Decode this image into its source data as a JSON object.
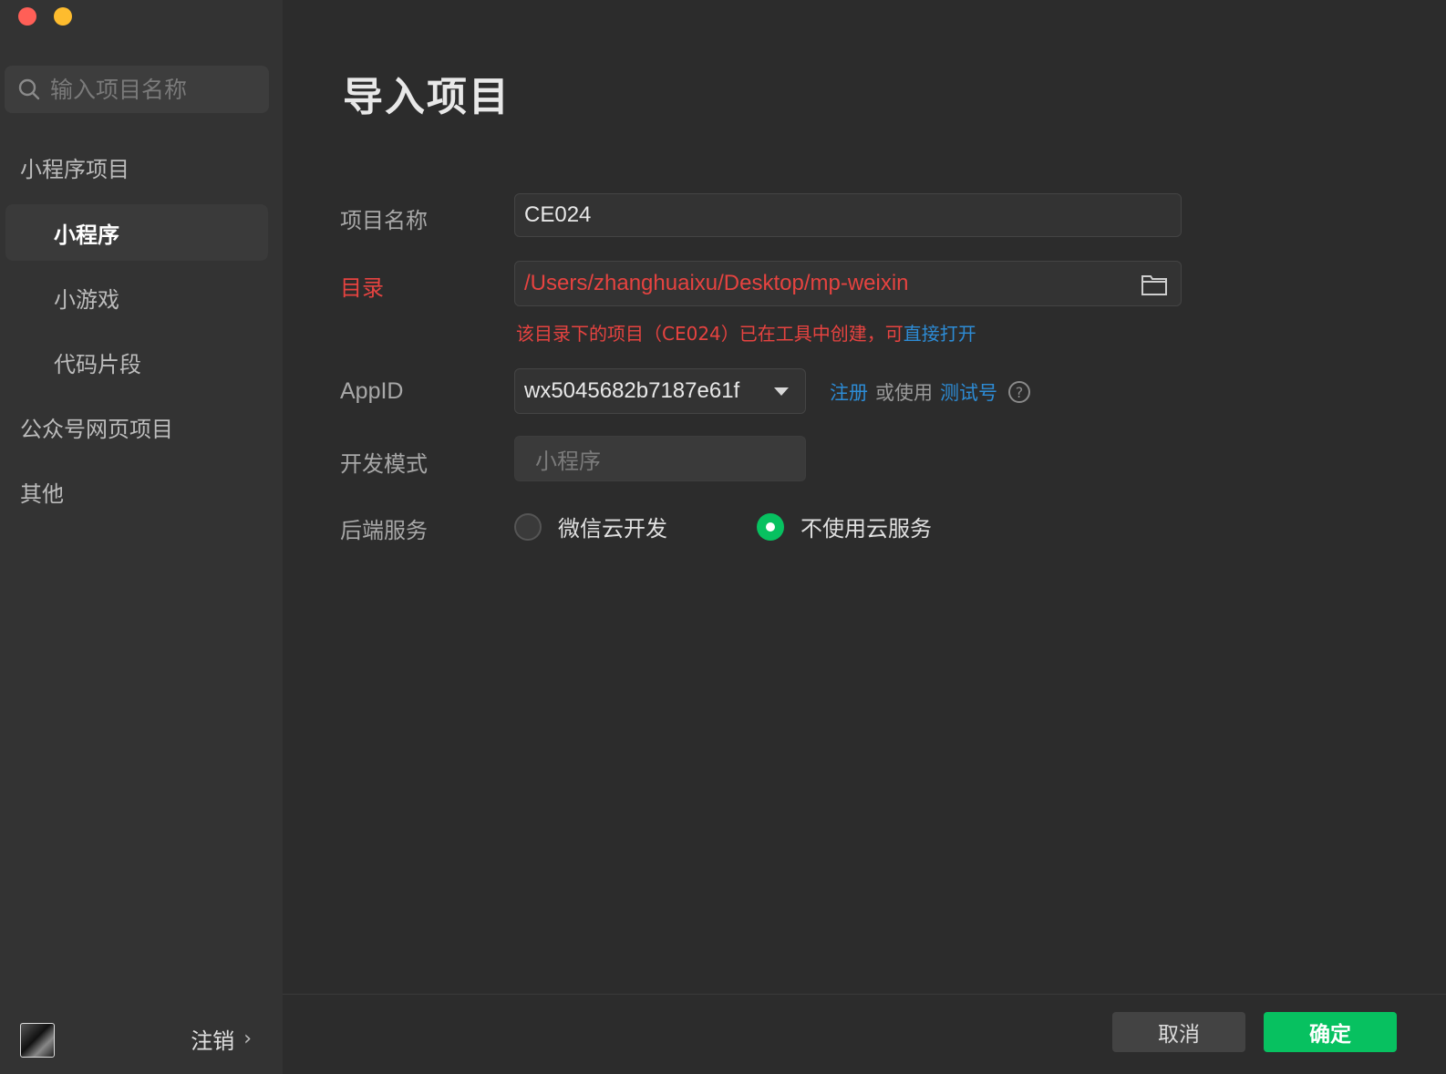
{
  "sidebar": {
    "search_placeholder": "输入项目名称",
    "groups": [
      {
        "label": "小程序项目"
      },
      {
        "label": "公众号网页项目"
      },
      {
        "label": "其他"
      }
    ],
    "items": [
      {
        "label": "小程序",
        "active": true
      },
      {
        "label": "小游戏",
        "active": false
      },
      {
        "label": "代码片段",
        "active": false
      }
    ],
    "logout_label": "注销"
  },
  "main": {
    "title": "导入项目",
    "project_name": {
      "label": "项目名称",
      "value": "CE024"
    },
    "directory": {
      "label": "目录",
      "value": "/Users/zhanghuaixu/Desktop/mp-weixin",
      "hint_text": "该目录下的项目（CE024）已在工具中创建，可",
      "hint_link": "直接打开"
    },
    "appid": {
      "label": "AppID",
      "value": "wx5045682b7187e61f",
      "register_link": "注册",
      "or_use": "或使用",
      "test_link": "测试号",
      "help": "?"
    },
    "dev_mode": {
      "label": "开发模式",
      "value": "小程序"
    },
    "backend": {
      "label": "后端服务",
      "options": [
        {
          "label": "微信云开发",
          "checked": false
        },
        {
          "label": "不使用云服务",
          "checked": true
        }
      ]
    }
  },
  "footer": {
    "cancel_label": "取消",
    "ok_label": "确定"
  },
  "colors": {
    "accent_green": "#07c160",
    "error_red": "#e64340",
    "link_blue": "#2d8cd6"
  }
}
